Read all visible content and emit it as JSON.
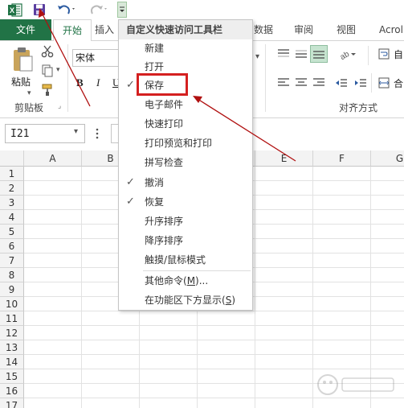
{
  "qat": {
    "excel_icon": "excel-logo",
    "save_icon": "floppy-disk",
    "undo_icon": "undo-arrow",
    "redo_icon": "redo-arrow",
    "customize_icon": "dropdown-arrow"
  },
  "tabs": {
    "file": "文件",
    "home": "开始",
    "insert": "插入",
    "data": "数据",
    "review": "审阅",
    "view": "视图",
    "acrobat": "Acrol"
  },
  "ribbon": {
    "paste": "粘贴",
    "clipboard_group": "剪贴板",
    "font_name": "宋体",
    "bold": "B",
    "italic": "I",
    "underline": "U",
    "alignment_group": "对齐方式",
    "wrap_partial": "自",
    "merge_partial": "合"
  },
  "formula_bar": {
    "name_box": "I21",
    "more_icon": "vertical-ellipsis"
  },
  "grid": {
    "columns": [
      "A",
      "B",
      "C",
      "D",
      "E",
      "F",
      "G"
    ],
    "rows": [
      "1",
      "2",
      "3",
      "4",
      "5",
      "6",
      "7",
      "8",
      "9",
      "10",
      "11",
      "12",
      "13",
      "14",
      "15",
      "16",
      "17"
    ]
  },
  "menu": {
    "title": "自定义快速访问工具栏",
    "items": [
      {
        "label": "新建",
        "checked": false
      },
      {
        "label": "打开",
        "checked": false
      },
      {
        "label": "保存",
        "checked": true
      },
      {
        "label": "电子邮件",
        "checked": false
      },
      {
        "label": "快速打印",
        "checked": false
      },
      {
        "label": "打印预览和打印",
        "checked": false
      },
      {
        "label": "拼写检查",
        "checked": false
      },
      {
        "label": "撤消",
        "checked": true
      },
      {
        "label": "恢复",
        "checked": true
      },
      {
        "label": "升序排序",
        "checked": false
      },
      {
        "label": "降序排序",
        "checked": false
      },
      {
        "label": "触摸/鼠标模式",
        "checked": false
      }
    ],
    "more_commands": "其他命令(",
    "more_commands_key": "M",
    "more_commands_suffix": ")...",
    "show_below": "在功能区下方显示(",
    "show_below_key": "S",
    "show_below_suffix": ")",
    "check_mark": "✓"
  },
  "annotation": {
    "highlight_color": "#d42020",
    "arrow_color": "#b01010"
  },
  "colors": {
    "excel_green": "#217346"
  }
}
